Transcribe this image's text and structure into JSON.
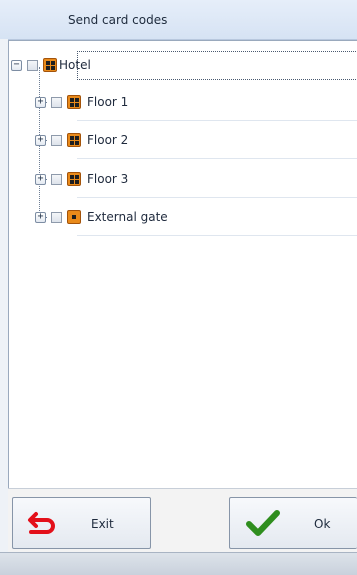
{
  "window": {
    "title": "Send card codes"
  },
  "tree": {
    "root": {
      "label": "Hotel",
      "expander": "−",
      "checked": false,
      "icon": "floor-grid-icon"
    },
    "children": [
      {
        "label": "Floor 1",
        "expander": "+",
        "checked": false,
        "icon": "floor-grid-icon"
      },
      {
        "label": "Floor 2",
        "expander": "+",
        "checked": false,
        "icon": "floor-grid-icon"
      },
      {
        "label": "Floor 3",
        "expander": "+",
        "checked": false,
        "icon": "floor-grid-icon"
      },
      {
        "label": "External gate",
        "expander": "+",
        "checked": false,
        "icon": "gate-square-icon"
      }
    ]
  },
  "buttons": {
    "exit_label": "Exit",
    "exit_icon": "undo-arrow-icon",
    "ok_label": "Ok",
    "ok_icon": "checkmark-icon"
  },
  "colors": {
    "node_icon": "#e98a1a",
    "exit_arrow": "#e3101a",
    "ok_check": "#2f8e1e"
  }
}
